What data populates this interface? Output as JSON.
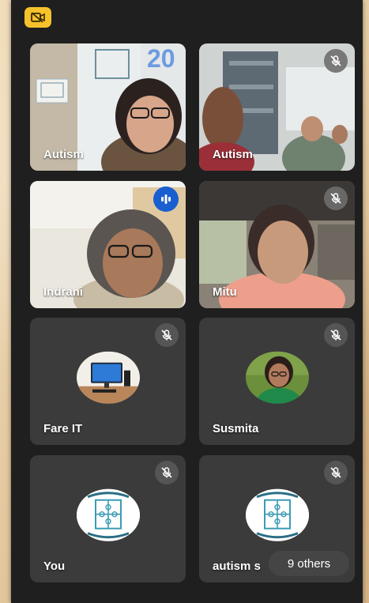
{
  "header": {
    "camera_toggle_icon": "video-off-icon"
  },
  "participants": [
    {
      "name": "Autism",
      "muted": false,
      "speaking": false
    },
    {
      "name": "Autism",
      "muted": true,
      "speaking": false
    },
    {
      "name": "Indrani",
      "muted": false,
      "speaking": true
    },
    {
      "name": "Mitu",
      "muted": true,
      "speaking": false
    },
    {
      "name": "Fare IT",
      "muted": true,
      "speaking": false
    },
    {
      "name": "Susmita",
      "muted": true,
      "speaking": false
    },
    {
      "name": "You",
      "muted": true,
      "speaking": false
    },
    {
      "name": "autism s",
      "muted": true,
      "speaking": false
    }
  ],
  "overflow": {
    "others_label": "9 others"
  },
  "banner_text": "20",
  "colors": {
    "accent_blue": "#1a5fd0",
    "cam_off_yellow": "#f6c22b",
    "tile_bg": "#3b3b3b",
    "screen_bg": "#1f1f1f"
  }
}
